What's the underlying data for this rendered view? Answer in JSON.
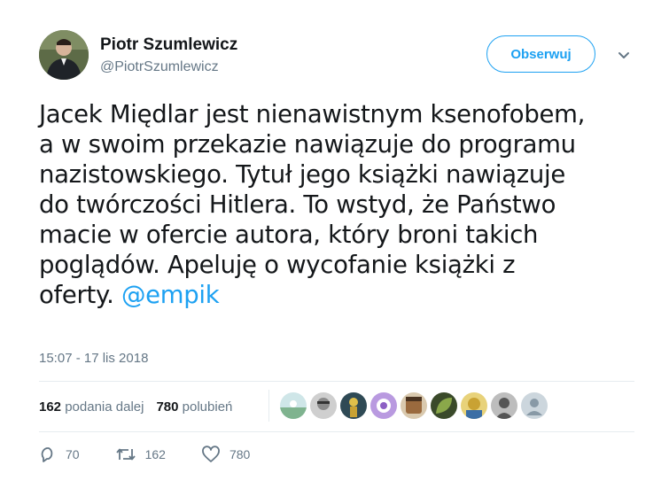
{
  "author": {
    "name": "Piotr Szumlewicz",
    "handle": "@PiotrSzumlewicz"
  },
  "follow_button": {
    "label": "Obserwuj"
  },
  "tweet": {
    "text": "Jacek Międlar jest nienawistnym ksenofobem,\na w swoim przekazie nawiązuje do programu\nnazistowskiego. Tytuł jego książki nawiązuje\ndo twórczości Hitlera. To wstyd, że Państwo\nmacie w ofercie autora, który broni takich\npoglądów. Apeluję o wycofanie książki z\noferty. ",
    "mention": "@empik"
  },
  "timestamp": "15:07 - 17 lis 2018",
  "stats": {
    "retweets_count": "162",
    "retweets_label": "podania dalej",
    "likes_count": "780",
    "likes_label": "polubień"
  },
  "liker_avatars": [
    {
      "icon": "avatar-landscape",
      "color": "#7fb38f"
    },
    {
      "icon": "avatar-face-bw",
      "color": "#8a8a8a"
    },
    {
      "icon": "avatar-dark-figure",
      "color": "#2f4a55"
    },
    {
      "icon": "avatar-purple-flower",
      "color": "#8c5fc4"
    },
    {
      "icon": "avatar-brown-dog",
      "color": "#9a6a3e"
    },
    {
      "icon": "avatar-green-leaf",
      "color": "#6f8a3a"
    },
    {
      "icon": "avatar-colorful",
      "color": "#c9a233"
    },
    {
      "icon": "avatar-person-bw",
      "color": "#555555"
    },
    {
      "icon": "avatar-default-egg",
      "color": "#ccd6dd"
    }
  ],
  "actions": {
    "reply_count": "70",
    "retweet_count": "162",
    "like_count": "780"
  },
  "colors": {
    "accent": "#1da1f2",
    "secondary_text": "#657786",
    "divider": "#e6ecf0"
  }
}
